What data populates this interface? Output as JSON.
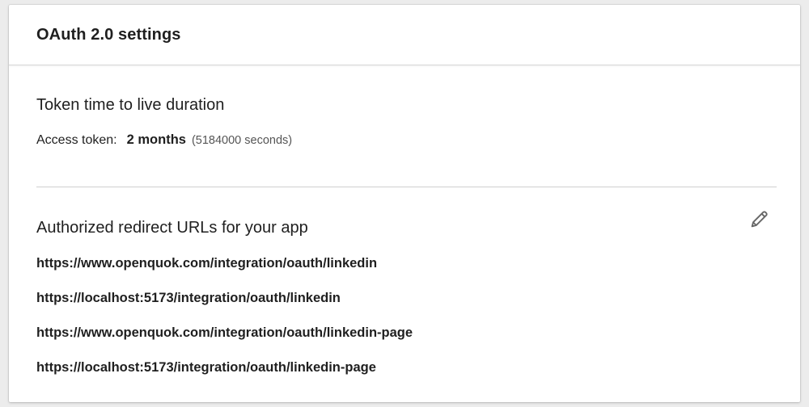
{
  "header": {
    "title": "OAuth 2.0 settings"
  },
  "token_ttl": {
    "heading": "Token time to live duration",
    "access_token_label": "Access token:",
    "access_token_value": "2 months",
    "access_token_seconds": "(5184000 seconds)"
  },
  "redirect_urls": {
    "heading": "Authorized redirect URLs for your app",
    "edit_icon": "pencil-icon",
    "items": [
      "https://www.openquok.com/integration/oauth/linkedin",
      "https://localhost:5173/integration/oauth/linkedin",
      "https://www.openquok.com/integration/oauth/linkedin-page",
      "https://localhost:5173/integration/oauth/linkedin-page"
    ]
  },
  "colors": {
    "background": "#ececec",
    "card": "#ffffff",
    "text": "#1f1f1f",
    "muted": "#555555",
    "icon": "#666666"
  }
}
